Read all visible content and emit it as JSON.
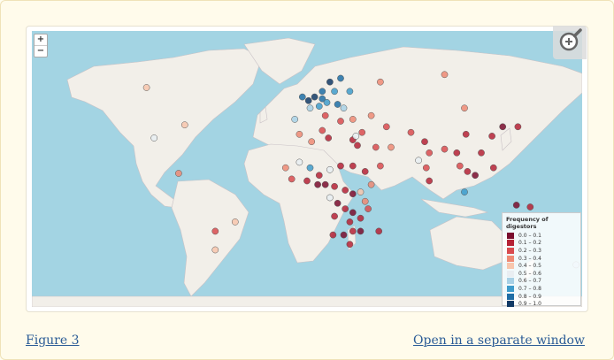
{
  "figure": {
    "figure_link": "Figure 3",
    "window_link": "Open in a separate window"
  },
  "map_controls": {
    "zoom_in": "+",
    "zoom_out": "−",
    "expand_icon": "magnifier-plus-icon"
  },
  "legend": {
    "title": "Frequency of digestors",
    "items": [
      {
        "label": "0.0 – 0.1",
        "color": "#7a0d2e"
      },
      {
        "label": "0.1 – 0.2",
        "color": "#b52236"
      },
      {
        "label": "0.2 – 0.3",
        "color": "#d94b4f"
      },
      {
        "label": "0.3 – 0.4",
        "color": "#ef8a74"
      },
      {
        "label": "0.4 – 0.5",
        "color": "#f8c6ad"
      },
      {
        "label": "0.5 – 0.6",
        "color": "#e9eef2"
      },
      {
        "label": "0.6 – 0.7",
        "color": "#a8d1e6"
      },
      {
        "label": "0.7 – 0.8",
        "color": "#3f9ccb"
      },
      {
        "label": "0.8 – 0.9",
        "color": "#1f6ea6"
      },
      {
        "label": "0.9 – 1.0",
        "color": "#123a66"
      }
    ]
  },
  "colors": {
    "water": "#a3d4e3",
    "land": "#f2efe9",
    "border": "#c9c2c6"
  },
  "points": [
    {
      "lon": -105,
      "lat": 57,
      "c": 4
    },
    {
      "lon": -80,
      "lat": 37,
      "c": 4
    },
    {
      "lon": -100,
      "lat": 30,
      "c": 5
    },
    {
      "lon": -84,
      "lat": 11,
      "c": 3
    },
    {
      "lon": -47,
      "lat": -15,
      "c": 4
    },
    {
      "lon": -60,
      "lat": -30,
      "c": 4
    },
    {
      "lon": -60,
      "lat": -20,
      "c": 2
    },
    {
      "lon": -3,
      "lat": 52,
      "c": 8
    },
    {
      "lon": 1,
      "lat": 50,
      "c": 9
    },
    {
      "lon": 5,
      "lat": 52,
      "c": 9
    },
    {
      "lon": 10,
      "lat": 55,
      "c": 8
    },
    {
      "lon": 10,
      "lat": 51,
      "c": 8
    },
    {
      "lon": 15,
      "lat": 60,
      "c": 9
    },
    {
      "lon": 18,
      "lat": 55,
      "c": 7
    },
    {
      "lon": 2,
      "lat": 46,
      "c": 6
    },
    {
      "lon": 8,
      "lat": 47,
      "c": 7
    },
    {
      "lon": 13,
      "lat": 49,
      "c": 7
    },
    {
      "lon": 20,
      "lat": 48,
      "c": 8
    },
    {
      "lon": 24,
      "lat": 46,
      "c": 6
    },
    {
      "lon": 22,
      "lat": 62,
      "c": 8
    },
    {
      "lon": 28,
      "lat": 55,
      "c": 7
    },
    {
      "lon": -8,
      "lat": 40,
      "c": 6
    },
    {
      "lon": 12,
      "lat": 42,
      "c": 2
    },
    {
      "lon": 22,
      "lat": 39,
      "c": 2
    },
    {
      "lon": 30,
      "lat": 40,
      "c": 3
    },
    {
      "lon": 48,
      "lat": 60,
      "c": 3
    },
    {
      "lon": 90,
      "lat": 64,
      "c": 3
    },
    {
      "lon": 42,
      "lat": 42,
      "c": 3
    },
    {
      "lon": 52,
      "lat": 36,
      "c": 2
    },
    {
      "lon": 68,
      "lat": 33,
      "c": 2
    },
    {
      "lon": 77,
      "lat": 28,
      "c": 1
    },
    {
      "lon": 80,
      "lat": 22,
      "c": 2
    },
    {
      "lon": 78,
      "lat": 14,
      "c": 2
    },
    {
      "lon": 80,
      "lat": 7,
      "c": 1
    },
    {
      "lon": 90,
      "lat": 24,
      "c": 2
    },
    {
      "lon": 73,
      "lat": 18,
      "c": 5
    },
    {
      "lon": 100,
      "lat": 15,
      "c": 2
    },
    {
      "lon": 98,
      "lat": 22,
      "c": 1
    },
    {
      "lon": 105,
      "lat": 12,
      "c": 1
    },
    {
      "lon": 110,
      "lat": 10,
      "c": 0
    },
    {
      "lon": 104,
      "lat": 32,
      "c": 1
    },
    {
      "lon": 103,
      "lat": 46,
      "c": 3
    },
    {
      "lon": 103,
      "lat": 1,
      "c": 7
    },
    {
      "lon": 114,
      "lat": 22,
      "c": 1
    },
    {
      "lon": 121,
      "lat": 31,
      "c": 1
    },
    {
      "lon": 122,
      "lat": 14,
      "c": 1
    },
    {
      "lon": 128,
      "lat": 36,
      "c": 0
    },
    {
      "lon": 138,
      "lat": 36,
      "c": 1
    },
    {
      "lon": 137,
      "lat": -6,
      "c": 0
    },
    {
      "lon": 134,
      "lat": -25,
      "c": 4
    },
    {
      "lon": 146,
      "lat": -7,
      "c": 1
    },
    {
      "lon": 176,
      "lat": -38,
      "c": 6
    },
    {
      "lon": -5,
      "lat": 32,
      "c": 3
    },
    {
      "lon": 3,
      "lat": 28,
      "c": 3
    },
    {
      "lon": 10,
      "lat": 34,
      "c": 2
    },
    {
      "lon": 14,
      "lat": 30,
      "c": 1
    },
    {
      "lon": 30,
      "lat": 29,
      "c": 1
    },
    {
      "lon": 32,
      "lat": 31,
      "c": 5
    },
    {
      "lon": 33,
      "lat": 26,
      "c": 1
    },
    {
      "lon": 36,
      "lat": 33,
      "c": 2
    },
    {
      "lon": 45,
      "lat": 25,
      "c": 2
    },
    {
      "lon": 55,
      "lat": 25,
      "c": 3
    },
    {
      "lon": 48,
      "lat": 15,
      "c": 2
    },
    {
      "lon": -14,
      "lat": 14,
      "c": 3
    },
    {
      "lon": -5,
      "lat": 17,
      "c": 5
    },
    {
      "lon": 2,
      "lat": 14,
      "c": 7
    },
    {
      "lon": 8,
      "lat": 10,
      "c": 1
    },
    {
      "lon": 15,
      "lat": 13,
      "c": 5
    },
    {
      "lon": 22,
      "lat": 15,
      "c": 1
    },
    {
      "lon": 30,
      "lat": 15,
      "c": 1
    },
    {
      "lon": 38,
      "lat": 12,
      "c": 1
    },
    {
      "lon": 42,
      "lat": 5,
      "c": 3
    },
    {
      "lon": -10,
      "lat": 8,
      "c": 2
    },
    {
      "lon": 0,
      "lat": 7,
      "c": 1
    },
    {
      "lon": 7,
      "lat": 5,
      "c": 0
    },
    {
      "lon": 12,
      "lat": 5,
      "c": 0
    },
    {
      "lon": 18,
      "lat": 4,
      "c": 1
    },
    {
      "lon": 25,
      "lat": 2,
      "c": 1
    },
    {
      "lon": 30,
      "lat": 0,
      "c": 0
    },
    {
      "lon": 35,
      "lat": 1,
      "c": 4
    },
    {
      "lon": 38,
      "lat": -4,
      "c": 3
    },
    {
      "lon": 40,
      "lat": -8,
      "c": 2
    },
    {
      "lon": 15,
      "lat": -2,
      "c": 5
    },
    {
      "lon": 20,
      "lat": -5,
      "c": 0
    },
    {
      "lon": 25,
      "lat": -8,
      "c": 1
    },
    {
      "lon": 30,
      "lat": -10,
      "c": 0
    },
    {
      "lon": 35,
      "lat": -13,
      "c": 1
    },
    {
      "lon": 28,
      "lat": -15,
      "c": 1
    },
    {
      "lon": 18,
      "lat": -12,
      "c": 1
    },
    {
      "lon": 35,
      "lat": -20,
      "c": 0
    },
    {
      "lon": 30,
      "lat": -20,
      "c": 1
    },
    {
      "lon": 24,
      "lat": -22,
      "c": 0
    },
    {
      "lon": 17,
      "lat": -22,
      "c": 1
    },
    {
      "lon": 28,
      "lat": -27,
      "c": 1
    },
    {
      "lon": 47,
      "lat": -20,
      "c": 1
    }
  ]
}
